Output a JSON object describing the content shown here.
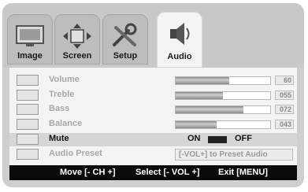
{
  "tabs": [
    {
      "label": "Image",
      "icon": "monitor-icon",
      "active": false
    },
    {
      "label": "Screen",
      "icon": "arrows-icon",
      "active": false
    },
    {
      "label": "Setup",
      "icon": "tools-icon",
      "active": false
    },
    {
      "label": "Audio",
      "icon": "speaker-icon",
      "active": true
    }
  ],
  "rows": [
    {
      "label": "Volume",
      "icon": "volume-icon",
      "level": 0.57,
      "value": "60"
    },
    {
      "label": "Treble",
      "icon": "treble-icon",
      "level": 0.5,
      "value": "055"
    },
    {
      "label": "Bass",
      "icon": "bass-icon",
      "level": 0.72,
      "value": "072"
    },
    {
      "label": "Balance",
      "icon": "balance-icon",
      "level": 0.43,
      "value": "043"
    }
  ],
  "mute": {
    "label": "Mute",
    "on": "ON",
    "off": "OFF",
    "icon": "mute-icon"
  },
  "preset": {
    "label": "Audio Preset",
    "hint": "[-VOL+]  to Preset Audio",
    "icon": "preset-icon"
  },
  "footer": {
    "move": "Move [- CH +]",
    "select": "Select [- VOL +]",
    "exit": "Exit [MENU]"
  },
  "colors": {
    "background": "#cfcfcf",
    "panel": "#f4f4f4",
    "footer": "#0b0b0b"
  }
}
